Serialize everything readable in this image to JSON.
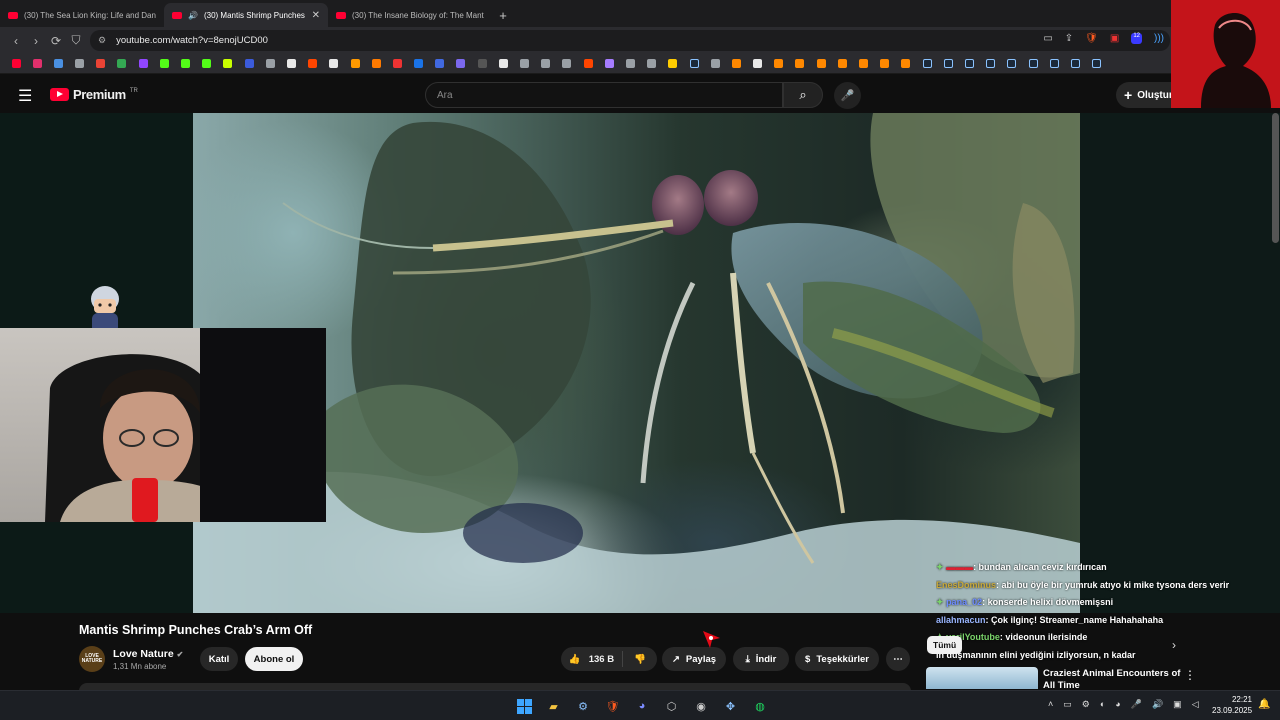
{
  "browser": {
    "tabs": [
      {
        "title": "(30) The Sea Lion King: Life and Dang",
        "active": false
      },
      {
        "title": "(30) Mantis Shrimp Punches",
        "active": true
      },
      {
        "title": "(30) The Insane Biology of: The Mant",
        "active": false
      }
    ],
    "new_tab": "+",
    "tab_close": "✕",
    "url": "youtube.com/watch?v=8enojUCD00",
    "ext_badge": "12"
  },
  "youtube": {
    "logo_text": "Premium",
    "logo_region": "TR",
    "search_placeholder": "Ara",
    "create_label": "Oluştur"
  },
  "video": {
    "title": "Mantis Shrimp Punches Crab’s Arm Off",
    "channel_avatar_text": "LOVE NATURE",
    "channel_name": "Love Nature",
    "subscribers": "1,31 Mn abone",
    "join_label": "Katıl",
    "subscribe_label": "Abone ol",
    "likes": "136 B",
    "share_label": "Paylaş",
    "download_label": "İndir",
    "thanks_label": "Teşekkürler",
    "more_label": "⋯"
  },
  "chat": [
    {
      "user": "▬▬▬",
      "msg": ": bundan alıcan ceviz kırdırıcan",
      "cls": "u1",
      "icon": "✦"
    },
    {
      "user": "EnesDominus",
      "msg": ": abi bu öyle bir yumruk atıyo ki mike tysona ders verir",
      "cls": "u2",
      "icon": ""
    },
    {
      "user": "pana_02",
      "msg": ": konserde helixi dövmemişsni",
      "cls": "u3",
      "icon": "✦"
    },
    {
      "user": "allahmacun",
      "msg": ": Çok ilginç! Streamer_name Hahahahaha",
      "cls": "u4",
      "icon": ""
    },
    {
      "user": "yarilYoutube",
      "msg": ": videonun ilerisinde",
      "cls": "u5",
      "icon": "✦"
    },
    {
      "user": "",
      "msg": "ın düşmanının elini yediğini izliyorsun, n kadar",
      "cls": "",
      "icon": ""
    }
  ],
  "chip_label": "Tümü",
  "recommended": {
    "title": "Craziest Animal Encounters of All Time"
  },
  "taskbar": {
    "time": "22:21",
    "date": "23.09.2025"
  },
  "colors": {
    "youtube_red": "#ff0033",
    "background": "#0f0f0f",
    "chip": "#272727"
  }
}
